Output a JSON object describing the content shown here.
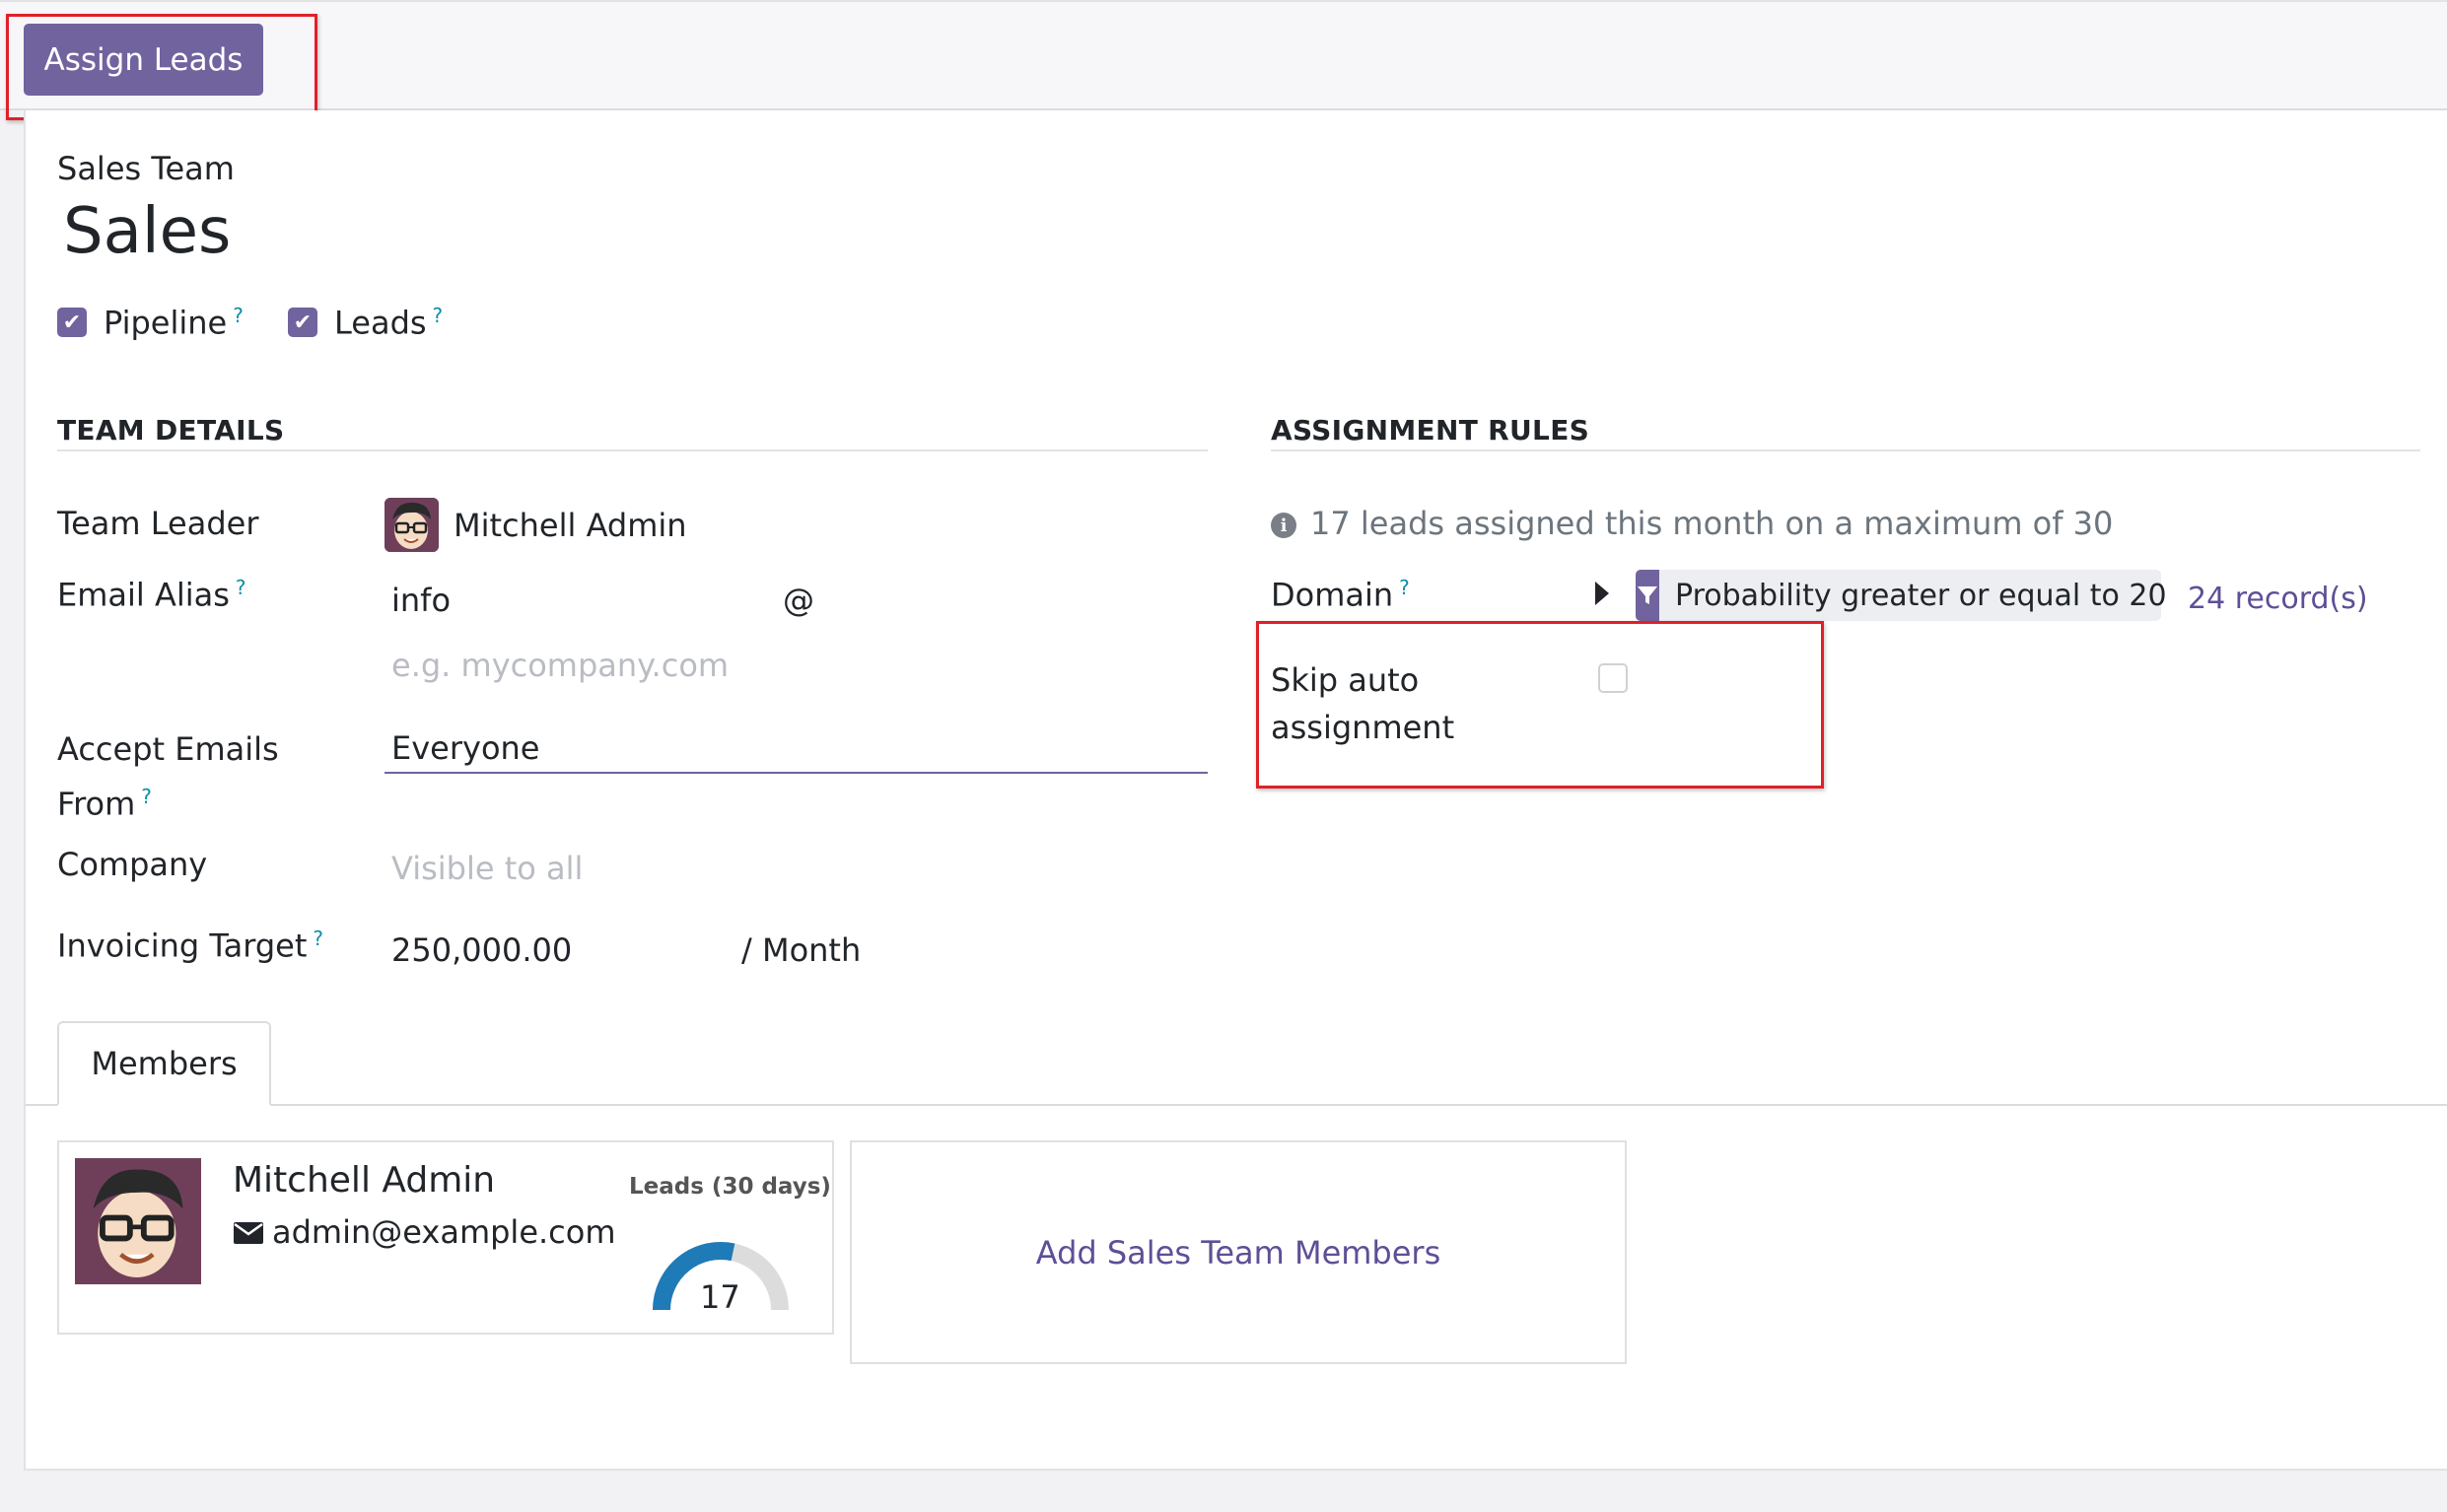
{
  "toolbar": {
    "assign_leads": "Assign Leads"
  },
  "header": {
    "label": "Sales Team",
    "name": "Sales",
    "checks": [
      {
        "label": "Pipeline",
        "checked": true,
        "help": "?"
      },
      {
        "label": "Leads",
        "checked": true,
        "help": "?"
      }
    ]
  },
  "team_details": {
    "title": "TEAM DETAILS",
    "team_leader_label": "Team Leader",
    "team_leader": "Mitchell Admin",
    "email_alias_label": "Email Alias",
    "email_alias_value": "info",
    "email_at": "@",
    "email_domain_placeholder": "e.g. mycompany.com",
    "accept_from_label_1": "Accept Emails",
    "accept_from_label_2": "From",
    "accept_from_value": "Everyone",
    "company_label": "Company",
    "company_placeholder": "Visible to all",
    "invoicing_label": "Invoicing Target",
    "invoicing_value": "250,000.00",
    "invoicing_unit": "/ Month",
    "help": "?"
  },
  "assignment_rules": {
    "title": "ASSIGNMENT RULES",
    "info": "17 leads assigned this month on a maximum of 30",
    "domain_label": "Domain",
    "domain_tag": "Probability greater or equal to 20",
    "records": "24 record(s)",
    "skip_label_1": "Skip auto",
    "skip_label_2": "assignment",
    "skip_checked": false
  },
  "tabs": {
    "members": "Members"
  },
  "member": {
    "name": "Mitchell Admin",
    "email": "admin@example.com",
    "leads_label": "Leads (30 days)",
    "leads_value": "17",
    "leads_max": 30,
    "leads_count": 17
  },
  "add_members": "Add Sales Team Members",
  "colors": {
    "primary": "#71639e",
    "highlight": "#e0202a",
    "gauge": "#1f7ab8",
    "gauge_bg": "#dcdcdc"
  }
}
